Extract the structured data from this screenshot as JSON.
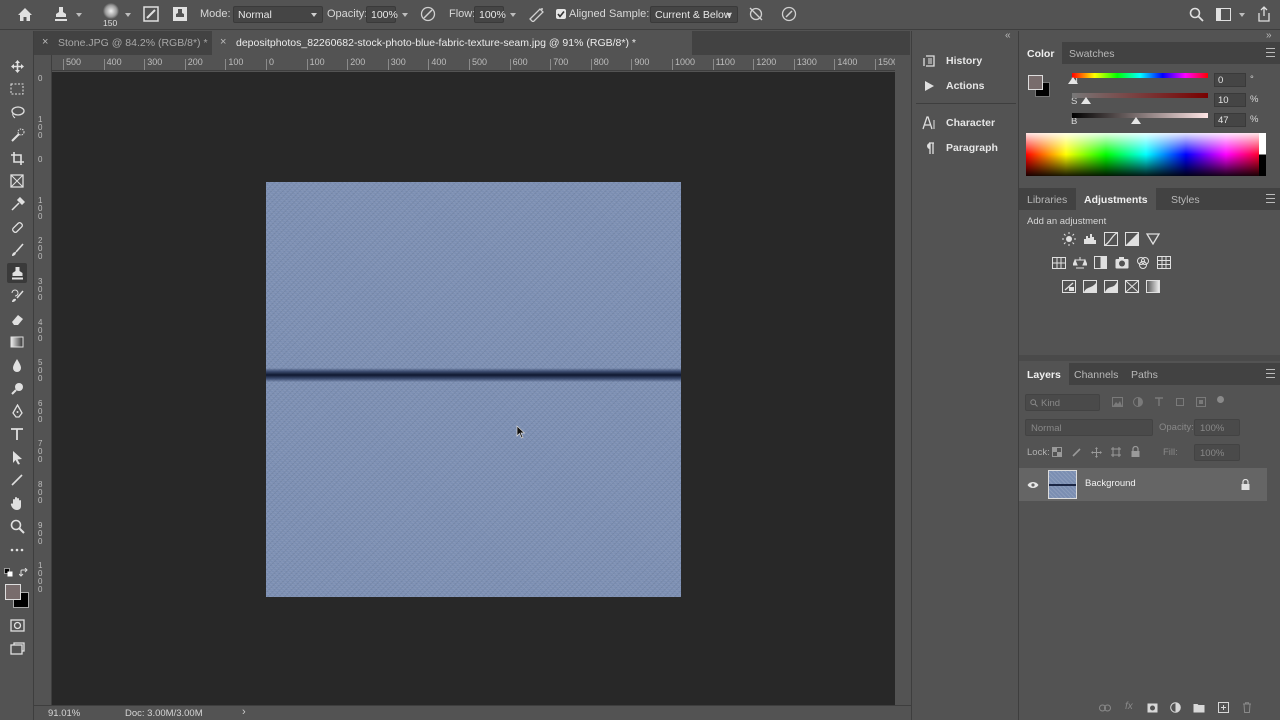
{
  "options_bar": {
    "brush_size": "150",
    "mode_label": "Mode:",
    "mode_value": "Normal",
    "opacity_label": "Opacity:",
    "opacity_value": "100%",
    "flow_label": "Flow:",
    "flow_value": "100%",
    "aligned_label": "Aligned",
    "aligned_checked": true,
    "sample_label": "Sample:",
    "sample_value": "Current & Below"
  },
  "tabs": [
    {
      "label": "Stone.JPG @ 84.2% (RGB/8*) *",
      "active": false
    },
    {
      "label": "depositphotos_82260682-stock-photo-blue-fabric-texture-seam.jpg @ 91% (RGB/8*) *",
      "active": true
    }
  ],
  "ruler": {
    "top_ticks": [
      "500",
      "400",
      "300",
      "200",
      "100",
      "0",
      "100",
      "200",
      "300",
      "400",
      "500",
      "600",
      "700",
      "800",
      "900",
      "1000",
      "1100",
      "1200",
      "1300",
      "1400",
      "1500"
    ],
    "left_ticks": [
      "0",
      "1\n0\n0",
      "0",
      "1\n0\n0",
      "2\n0\n0",
      "3\n0\n0",
      "4\n0\n0",
      "5\n0\n0",
      "6\n0\n0",
      "7\n0\n0",
      "8\n0\n0",
      "9\n0\n0",
      "1\n0\n0\n0"
    ]
  },
  "status_bar": {
    "zoom": "91.01%",
    "doc": "Doc: 3.00M/3.00M"
  },
  "mid_panel": {
    "items": [
      {
        "label": "History",
        "icon": "history-icon"
      },
      {
        "label": "Actions",
        "icon": "actions-play-icon"
      },
      {
        "label": "Character",
        "icon": "character-icon"
      },
      {
        "label": "Paragraph",
        "icon": "paragraph-icon"
      }
    ]
  },
  "color_panel": {
    "tabs": [
      "Color",
      "Swatches"
    ],
    "h_label": "H",
    "h_value": "0",
    "h_unit": "°",
    "s_label": "S",
    "s_value": "10",
    "s_unit": "%",
    "b_label": "B",
    "b_value": "47",
    "b_unit": "%",
    "foreground": "#786c6c",
    "background": "#000000"
  },
  "adjustments_panel": {
    "tabs": [
      "Libraries",
      "Adjustments",
      "Styles"
    ],
    "add_label": "Add an adjustment"
  },
  "layers_panel": {
    "tabs": [
      "Layers",
      "Channels",
      "Paths"
    ],
    "kind_placeholder": "Kind",
    "blend_mode": "Normal",
    "opacity_label": "Opacity:",
    "opacity_value": "100%",
    "lock_label": "Lock:",
    "fill_label": "Fill:",
    "fill_value": "100%",
    "layers": [
      {
        "name": "Background",
        "visible": true,
        "locked": true
      }
    ]
  },
  "colors": {
    "app_bg": "#535353",
    "canvas_bg": "#282828",
    "fabric": "#7b8eb2",
    "selected_layer": "#656565"
  }
}
